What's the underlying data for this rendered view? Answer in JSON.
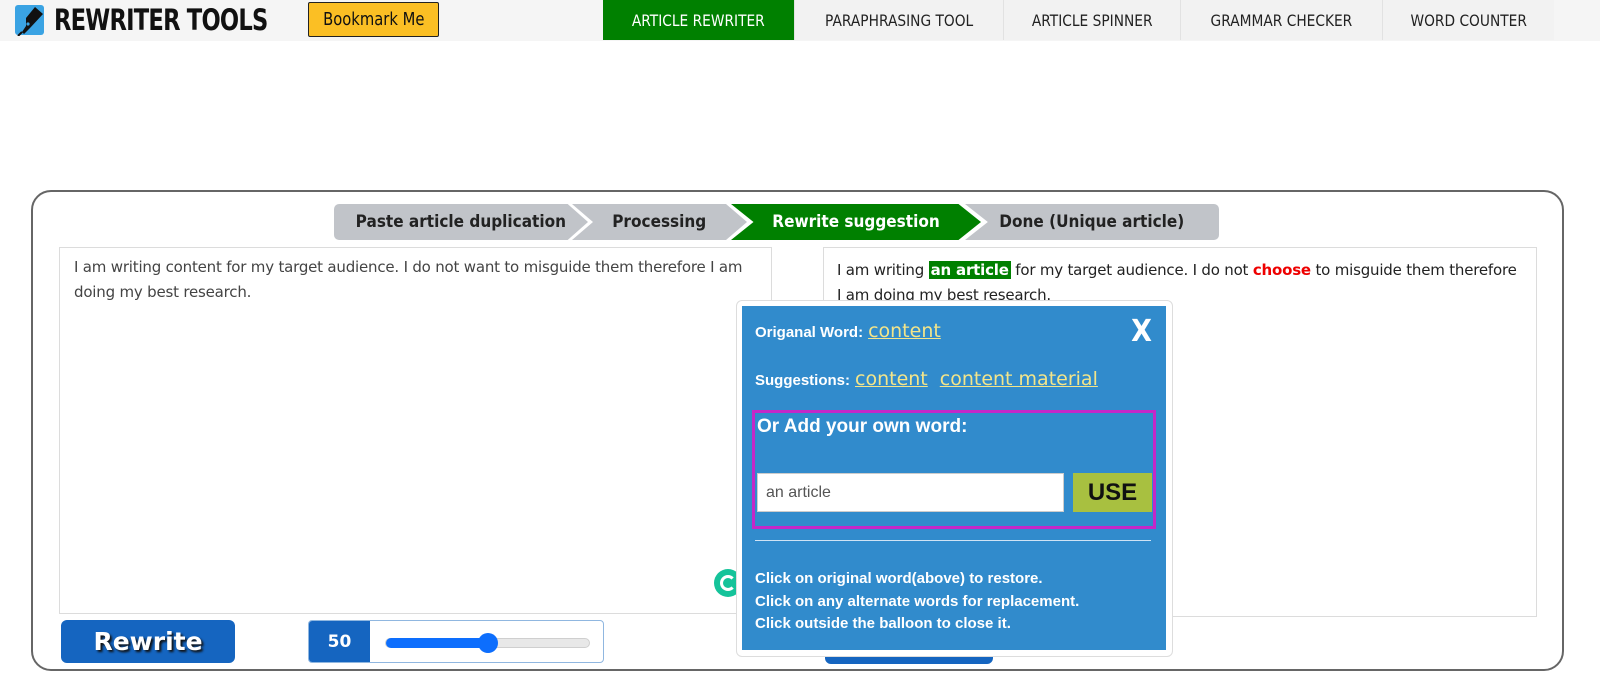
{
  "header": {
    "logo_text": "REWRITER TOOLS",
    "bookmark_label": "Bookmark Me",
    "nav": [
      {
        "label": "ARTICLE REWRITER",
        "active": true
      },
      {
        "label": "PARAPHRASING TOOL",
        "active": false
      },
      {
        "label": "ARTICLE SPINNER",
        "active": false
      },
      {
        "label": "GRAMMAR CHECKER",
        "active": false
      },
      {
        "label": "WORD COUNTER",
        "active": false
      }
    ]
  },
  "steps": [
    {
      "label": "Paste article duplication",
      "active": false
    },
    {
      "label": "Processing",
      "active": false
    },
    {
      "label": "Rewrite suggestion",
      "active": true
    },
    {
      "label": "Done (Unique article)",
      "active": false
    }
  ],
  "input_pane": {
    "text": "I am writing content for my target audience. I do not want to misguide them therefore I am doing my best research."
  },
  "output_pane": {
    "segments": {
      "part1": "I am writing ",
      "replaced_word": "an article",
      "part2": " for my target audience. I do not ",
      "changed_word": "choose",
      "part3": " to misguide them therefore I am doing my best research."
    }
  },
  "controls": {
    "rewrite_label": "Rewrite",
    "slider_value": "50",
    "slider_percent": 50
  },
  "balloon": {
    "original_label": "Origanal Word:",
    "original_word": "content",
    "close_label": "X",
    "suggestions_label": "Suggestions:",
    "suggestions": [
      "content",
      "content material"
    ],
    "own_word_label": "Or Add your own word:",
    "own_word_value": "an article",
    "use_label": "USE",
    "help": [
      "Click on original word(above) to restore.",
      "Click on any alternate words for replacement.",
      "Click outside the balloon to close it."
    ]
  },
  "colors": {
    "accent_green": "#008000",
    "bookmark_yellow": "#fbbf24",
    "primary_blue": "#1565c0",
    "balloon_blue": "#318bcc",
    "link_yellow": "#f3e58a",
    "use_green": "#a8c040",
    "highlight_magenta": "#c428c8",
    "changed_red": "#ee0000"
  }
}
